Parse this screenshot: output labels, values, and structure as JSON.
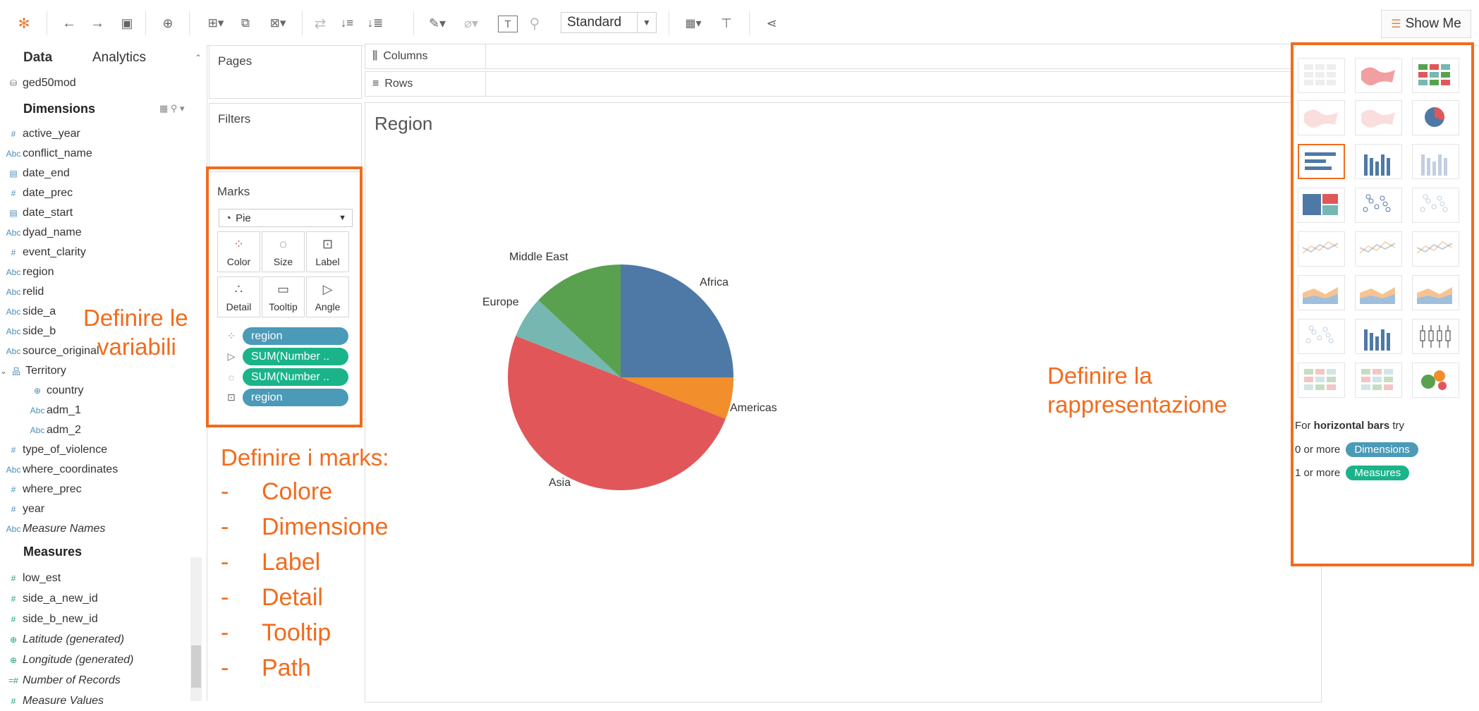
{
  "toolbar": {
    "view_select": "Standard",
    "show_me_label": "Show Me",
    "icons": [
      "tableau-logo-icon",
      "undo-icon",
      "redo-icon",
      "save-icon",
      "new-datasource-icon",
      "new-worksheet-icon",
      "duplicate-icon",
      "clear-icon",
      "swap-icon",
      "sort-asc-icon",
      "sort-desc-icon",
      "highlight-icon",
      "group-icon",
      "label-icon",
      "pin-icon",
      "fit-icon",
      "presentation-icon",
      "share-icon"
    ]
  },
  "data_pane": {
    "tab_data": "Data",
    "tab_analytics": "Analytics",
    "datasource": "ged50mod",
    "dimensions_header": "Dimensions",
    "dimensions": [
      {
        "icon": "#",
        "name": "active_year"
      },
      {
        "icon": "Abc",
        "name": "conflict_name"
      },
      {
        "icon": "cal",
        "name": "date_end"
      },
      {
        "icon": "#",
        "name": "date_prec"
      },
      {
        "icon": "cal",
        "name": "date_start"
      },
      {
        "icon": "Abc",
        "name": "dyad_name"
      },
      {
        "icon": "#",
        "name": "event_clarity"
      },
      {
        "icon": "Abc",
        "name": "region"
      },
      {
        "icon": "Abc",
        "name": "relid"
      },
      {
        "icon": "Abc",
        "name": "side_a"
      },
      {
        "icon": "Abc",
        "name": "side_b"
      },
      {
        "icon": "Abc",
        "name": "source_original"
      },
      {
        "icon": "hier",
        "name": "Territory"
      },
      {
        "icon": "globe",
        "name": "country"
      },
      {
        "icon": "Abc",
        "name": "adm_1"
      },
      {
        "icon": "Abc",
        "name": "adm_2"
      },
      {
        "icon": "#",
        "name": "type_of_violence"
      },
      {
        "icon": "Abc",
        "name": "where_coordinates"
      },
      {
        "icon": "#",
        "name": "where_prec"
      },
      {
        "icon": "#",
        "name": "year"
      },
      {
        "icon": "Abc",
        "name": "Measure Names"
      }
    ],
    "measures_header": "Measures",
    "measures": [
      {
        "icon": "#",
        "name": "low_est"
      },
      {
        "icon": "#",
        "name": "side_a_new_id"
      },
      {
        "icon": "#",
        "name": "side_b_new_id"
      },
      {
        "icon": "globe",
        "name": "Latitude (generated)"
      },
      {
        "icon": "globe",
        "name": "Longitude (generated)"
      },
      {
        "icon": "=#",
        "name": "Number of Records"
      },
      {
        "icon": "#",
        "name": "Measure Values"
      }
    ]
  },
  "shelves": {
    "pages": "Pages",
    "filters": "Filters",
    "columns": "Columns",
    "rows": "Rows"
  },
  "marks": {
    "title": "Marks",
    "mark_type": "Pie",
    "buttons": [
      "Color",
      "Size",
      "Label",
      "Detail",
      "Tooltip",
      "Angle"
    ],
    "pills": [
      {
        "kind": "color",
        "label": "region",
        "type": "dimension"
      },
      {
        "kind": "angle",
        "label": "SUM(Number ..",
        "type": "measure"
      },
      {
        "kind": "size",
        "label": "SUM(Number ..",
        "type": "measure"
      },
      {
        "kind": "label",
        "label": "region",
        "type": "dimension"
      }
    ]
  },
  "viz": {
    "title": "Region"
  },
  "chart_data": {
    "type": "pie",
    "title": "Region",
    "categories": [
      "Africa",
      "Americas",
      "Asia",
      "Europe",
      "Middle East"
    ],
    "values": [
      25,
      6,
      50,
      6,
      13
    ],
    "colors": [
      "#4e79a7",
      "#f28e2b",
      "#e15759",
      "#76b7b2",
      "#59a14f"
    ]
  },
  "show_me": {
    "hint_prefix": "For",
    "hint_bold": "horizontal bars",
    "hint_suffix": "try",
    "req1_prefix": "0 or more",
    "req1_pill": "Dimensions",
    "req2_prefix": "1 or more",
    "req2_pill": "Measures"
  },
  "annotations": {
    "vars_line1": "Definire le",
    "vars_line2": "variabili",
    "marks_title": "Definire i marks:",
    "marks_items": [
      "Colore",
      "Dimensione",
      "Label",
      "Detail",
      "Tooltip",
      "Path"
    ],
    "repr_line1": "Definire la",
    "repr_line2": "rappresentazione",
    "accent": "#f26b1d"
  }
}
